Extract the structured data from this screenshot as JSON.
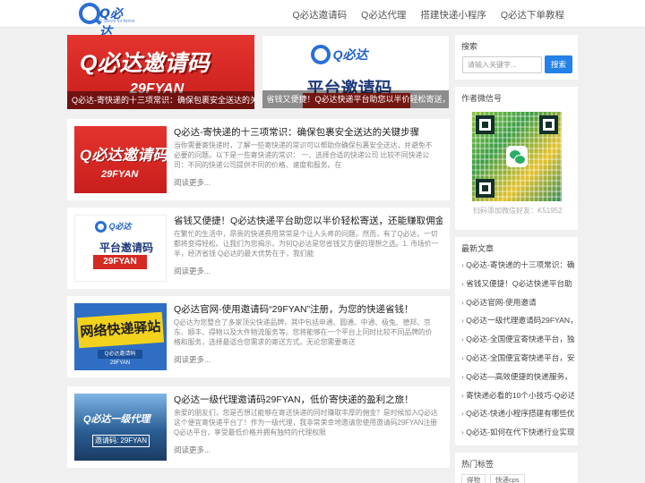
{
  "header": {
    "logo_text": "Q必达",
    "logo_sub": "Q Servis for Arrive",
    "nav": [
      "Q必达邀请码",
      "Q必达代理",
      "搭建快递小程序",
      "Q必达下单教程"
    ]
  },
  "featured": [
    {
      "image_text": "Q必达邀请码",
      "image_code": "29FYAN",
      "caption": "Q必达-寄快递的十三项常识：确保包裹安全送达的关键"
    },
    {
      "image_logo": "Q必达",
      "image_text": "平台邀请码",
      "caption": "省钱又便捷！Q必达快递平台助您以半价轻松寄送，还能"
    }
  ],
  "posts": [
    {
      "title": "Q必达-寄快递的十三项常识：确保包裹安全送达的关键步骤",
      "excerpt": "当你需要寄快递时，了解一些寄快递的常识可以帮助你确保包裹安全送达，并避免不必要的问题。以下是一些寄快递的常识： 一、选择合适的快递公司 比较不同快递公司：不同的快递公司提供不同的价格、速度和服务。在",
      "more": "阅读更多...",
      "thumb_a": "Q必达邀请码",
      "thumb_b": "29FYAN"
    },
    {
      "title": "省钱又便捷！Q必达快递平台助您以半价轻松寄送，还能赚取佣金！",
      "excerpt": "在繁忙的生活中，昂贵的快递费用常常是个让人头疼的问题。然而，有了Q必达，一切都将变得轻松。让我们为您揭示，为何Q必达是您省钱又方便的理想之选。1. 市场价一半，经济省钱 Q必达的最大优势在于，我们能",
      "more": "阅读更多...",
      "thumb_logo": "Q必达",
      "thumb_a": "平台邀请码",
      "thumb_b": "29FYAN"
    },
    {
      "title": "Q必达官网-使用邀请码“29FYAN”注册，为您的快递省钱！",
      "excerpt": "Q必达为您整合了多家顶尖快递品牌，其中包括申通、圆通、中通、极兔、德邦、京东、顺丰、得物以及大件物流服务等。您将能够在一个平台上同时比较不同品牌的价格和服务，选择最适合您需求的寄送方式。无论您需要寄送",
      "more": "阅读更多...",
      "thumb_a": "网络快递驿站",
      "thumb_b": "Q必达邀请码 29FYAN"
    },
    {
      "title": "Q必达一级代理邀请码29FYAN，低价寄快递的盈利之旅！",
      "excerpt": "亲爱的朋友们，您是否想过能够在寄送快递的同时赚取丰厚的佣金？是时候加入Q必达这个便宜寄快递平台了！作为一级代理，我非常荣幸地邀请您使用邀请码29FYAN注册Q必达平台，享受最低价格并拥有独特的代理权限",
      "more": "阅读更多...",
      "thumb_a": "Q必达一级代理",
      "thumb_b": "邀请码: 29FYAN"
    }
  ],
  "sidebar": {
    "search": {
      "title": "搜索",
      "placeholder": "请输入关键字...",
      "button": "搜索"
    },
    "wechat": {
      "title": "作者微信号",
      "caption": "扫码添加微信好友：K51952"
    },
    "recent": {
      "title": "最新文章",
      "items": [
        "Q必达-寄快递的十三项常识：确",
        "省钱又便捷！Q必达快递平台助",
        "Q必达官网-使用邀请",
        "Q必达一级代理邀请码29FYAN，",
        "Q必达-全国便宜寄快递平台，独",
        "Q必达-全国便宜寄快递平台，安",
        "Q必达—高效便捷的快递服务，",
        "寄快递必看的10个小技巧-Q必达",
        "Q必达-快递小程序搭建有哪些优",
        "Q必达-如何在代下快递行业实现"
      ]
    },
    "tags": {
      "title": "热门标签",
      "items": [
        "得物",
        "快递cps"
      ]
    }
  }
}
